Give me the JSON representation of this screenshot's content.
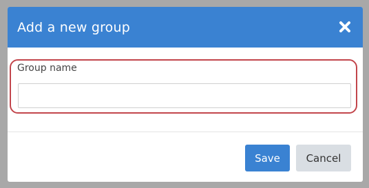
{
  "dialog": {
    "title": "Add a new group",
    "close_icon": "close-icon",
    "field": {
      "label": "Group name",
      "value": "",
      "placeholder": ""
    },
    "buttons": {
      "save_label": "Save",
      "cancel_label": "Cancel"
    }
  },
  "colors": {
    "header": "#3a82d2",
    "save_button": "#3a82d2",
    "cancel_button": "#d9dee3",
    "highlight_ring": "#c2454b",
    "backdrop": "#a8a8a8"
  }
}
